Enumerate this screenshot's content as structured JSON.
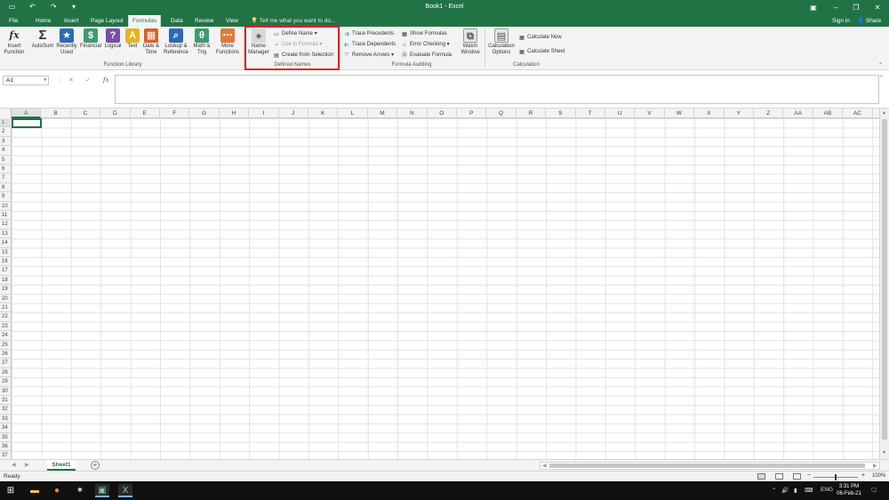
{
  "window": {
    "title": "Book1 - Excel"
  },
  "tabs": [
    {
      "label": "File",
      "x": 0
    },
    {
      "label": "Home"
    },
    {
      "label": "Insert"
    },
    {
      "label": "Page Layout"
    },
    {
      "label": "Formulas"
    },
    {
      "label": "Data"
    },
    {
      "label": "Review"
    },
    {
      "label": "View"
    }
  ],
  "active_tab": "Formulas",
  "tellme": "Tell me what you want to do...",
  "signin": "Sign in",
  "share": "Share",
  "ribbon": {
    "function_library": {
      "label": "Function Library",
      "insert_function": "Insert Function",
      "autosum": "AutoSum",
      "recently_used": "Recently Used",
      "financial": "Financial",
      "logical": "Logical",
      "text": "Text",
      "date_time": "Date & Time",
      "lookup": "Lookup & Reference",
      "math_trig": "Math & Trig",
      "more_functions": "More Functions"
    },
    "defined_names": {
      "label": "Defined Names",
      "name_manager": "Name Manager",
      "define_name": "Define Name",
      "use_in_formula": "Use in Formula",
      "create_from_selection": "Create from Selection"
    },
    "formula_auditing": {
      "label": "Formula Auditing",
      "trace_precedents": "Trace Precedents",
      "trace_dependents": "Trace Dependents",
      "remove_arrows": "Remove Arrows",
      "show_formulas": "Show Formulas",
      "error_checking": "Error Checking",
      "evaluate_formula": "Evaluate Formula",
      "watch_window": "Watch Window"
    },
    "calculation": {
      "label": "Calculation",
      "calculation_options": "Calculation Options",
      "calculate_now": "Calculate Now",
      "calculate_sheet": "Calculate Sheet"
    }
  },
  "formula_bar": {
    "name_box": "A1",
    "fx": "fx",
    "cancel": "✕",
    "enter": "✓"
  },
  "columns": [
    "A",
    "B",
    "C",
    "D",
    "E",
    "F",
    "G",
    "H",
    "I",
    "J",
    "K",
    "L",
    "M",
    "N",
    "O",
    "P",
    "Q",
    "R",
    "S",
    "T",
    "U",
    "V",
    "W",
    "X",
    "Y",
    "Z",
    "AA",
    "AB",
    "AC"
  ],
  "rows": [
    "1",
    "2",
    "3",
    "4",
    "5",
    "6",
    "7",
    "8",
    "9",
    "10",
    "11",
    "12",
    "13",
    "14",
    "15",
    "16",
    "17",
    "18",
    "19",
    "20",
    "21",
    "22",
    "23",
    "24",
    "25",
    "26",
    "27",
    "28",
    "29",
    "30",
    "31",
    "32",
    "33",
    "34",
    "35",
    "36",
    "37"
  ],
  "active_cell": "A1",
  "sheets": [
    {
      "label": "Sheet1",
      "active": true
    }
  ],
  "status": {
    "ready": "Ready",
    "zoom": "100%"
  },
  "taskbar": {
    "lang": "ENG",
    "time": "3:31 PM",
    "date": "06-Feb-21"
  }
}
